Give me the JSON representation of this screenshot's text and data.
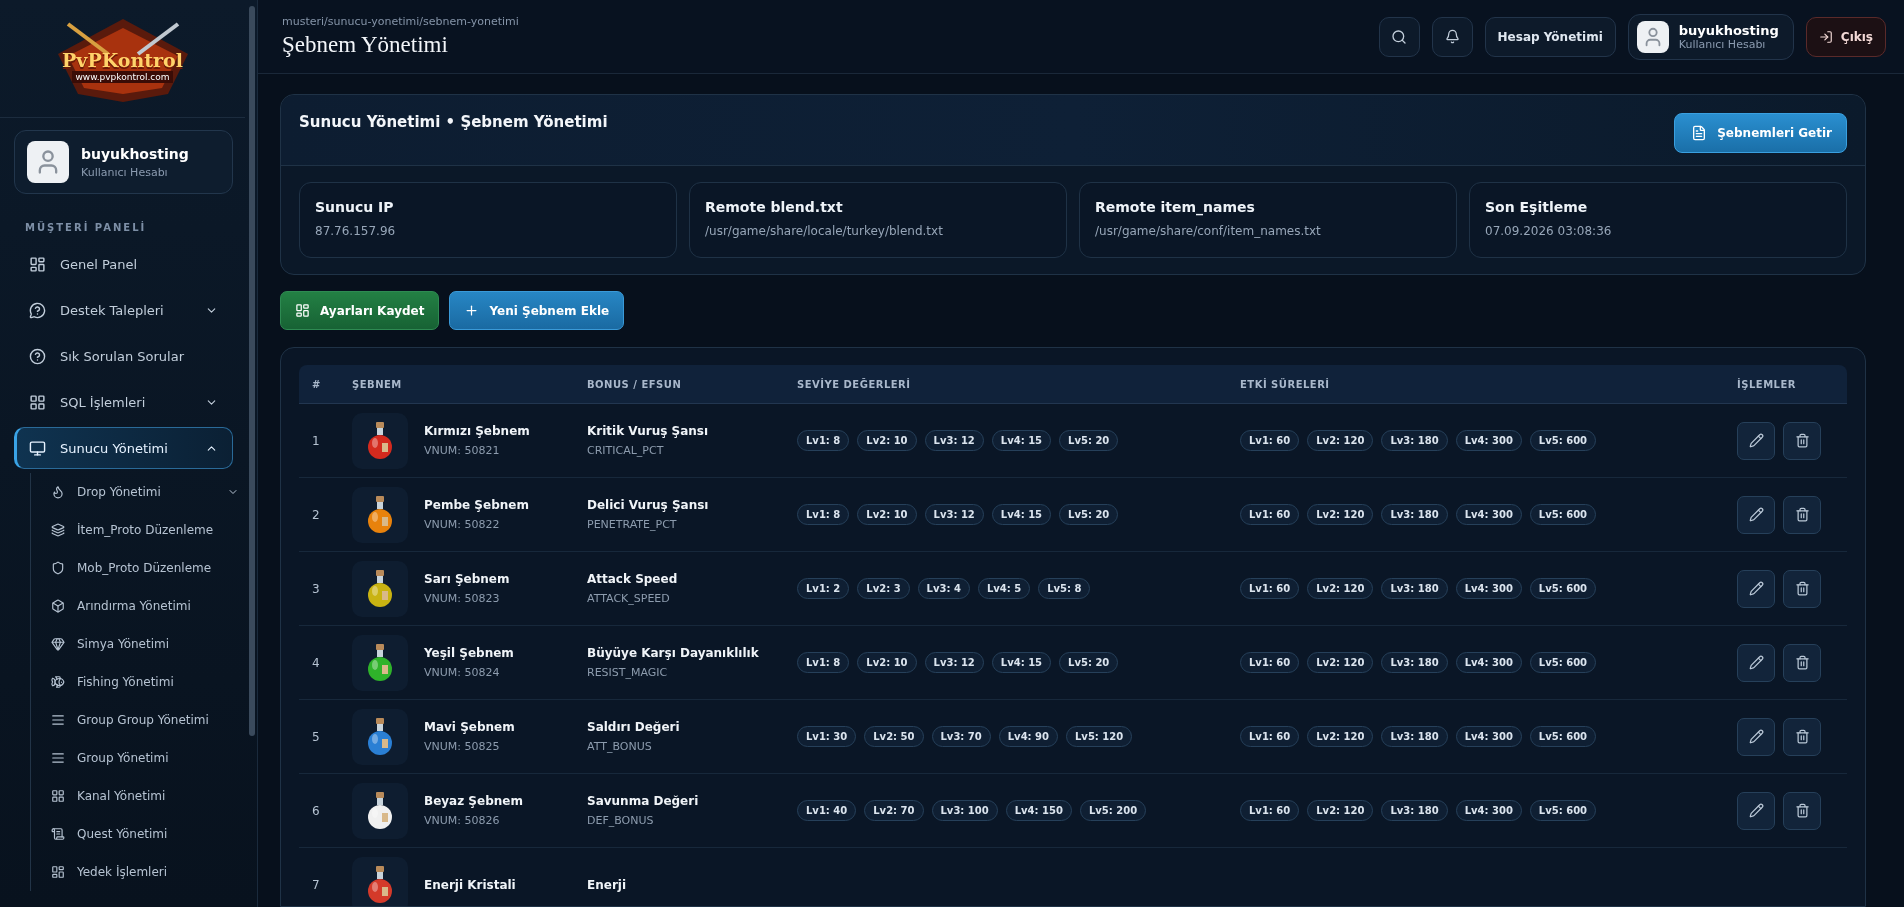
{
  "sidebar": {
    "logo": {
      "title": "PvPKontrol",
      "subtitle": "www.pvpkontrol.com"
    },
    "user": {
      "name": "buyukhosting",
      "role": "Kullanıcı Hesabı"
    },
    "section": "MÜŞTERİ PANELİ",
    "items": [
      {
        "label": "Genel Panel",
        "selected": false
      },
      {
        "label": "Destek Talepleri",
        "selected": false,
        "expanded": false
      },
      {
        "label": "Sık Sorulan Sorular",
        "selected": false
      },
      {
        "label": "SQL İşlemleri",
        "selected": false,
        "expanded": false
      },
      {
        "label": "Sunucu Yönetimi",
        "selected": true,
        "expanded": true,
        "children": [
          {
            "label": "Drop Yönetimi",
            "expanded": false
          },
          {
            "label": "İtem_Proto Düzenleme"
          },
          {
            "label": "Mob_Proto Düzenleme"
          },
          {
            "label": "Arındırma Yönetimi"
          },
          {
            "label": "Simya Yönetimi"
          },
          {
            "label": "Fishing Yönetimi"
          },
          {
            "label": "Group Group Yönetimi"
          },
          {
            "label": "Group Yönetimi"
          },
          {
            "label": "Kanal Yönetimi"
          },
          {
            "label": "Quest Yönetimi"
          },
          {
            "label": "Yedek İşlemleri"
          }
        ]
      }
    ]
  },
  "header": {
    "breadcrumb": "musteri/sunucu-yonetimi/sebnem-yonetimi",
    "title": "Şebnem Yönetimi",
    "account_button": "Hesap Yönetimi",
    "user": {
      "name": "buyukhosting",
      "role": "Kullanıcı Hesabı"
    },
    "logout": "Çıkış"
  },
  "panel": {
    "title": "Sunucu Yönetimi • Şebnem Yönetimi",
    "fetch_button": "Şebnemleri Getir",
    "info": [
      {
        "label": "Sunucu IP",
        "value": "87.76.157.96"
      },
      {
        "label": "Remote blend.txt",
        "value": "/usr/game/share/locale/turkey/blend.txt"
      },
      {
        "label": "Remote item_names",
        "value": "/usr/game/share/conf/item_names.txt"
      },
      {
        "label": "Son Eşitleme",
        "value": "07.09.2026 03:08:36"
      }
    ]
  },
  "actions": {
    "save": "Ayarları Kaydet",
    "add": "Yeni Şebnem Ekle"
  },
  "table": {
    "columns": [
      "#",
      "ŞEBNEM",
      "BONUS / EFSUN",
      "SEVİYE DEĞERLERİ",
      "ETKİ SÜRELERİ",
      "İŞLEMLER"
    ],
    "rows": [
      {
        "index": "1",
        "name": "Kırmızı Şebnem",
        "vnum": "VNUM: 50821",
        "color": "#d42a1e",
        "bonus": "Kritik Vuruş Şansı",
        "code": "CRITICAL_PCT",
        "levels": [
          "Lv1: 8",
          "Lv2: 10",
          "Lv3: 12",
          "Lv4: 15",
          "Lv5: 20"
        ],
        "durations": [
          "Lv1: 60",
          "Lv2: 120",
          "Lv3: 180",
          "Lv4: 300",
          "Lv5: 600"
        ]
      },
      {
        "index": "2",
        "name": "Pembe Şebnem",
        "vnum": "VNUM: 50822",
        "color": "#e8820c",
        "bonus": "Delici Vuruş Şansı",
        "code": "PENETRATE_PCT",
        "levels": [
          "Lv1: 8",
          "Lv2: 10",
          "Lv3: 12",
          "Lv4: 15",
          "Lv5: 20"
        ],
        "durations": [
          "Lv1: 60",
          "Lv2: 120",
          "Lv3: 180",
          "Lv4: 300",
          "Lv5: 600"
        ]
      },
      {
        "index": "3",
        "name": "Sarı Şebnem",
        "vnum": "VNUM: 50823",
        "color": "#c9b312",
        "bonus": "Attack Speed",
        "code": "ATTACK_SPEED",
        "levels": [
          "Lv1: 2",
          "Lv2: 3",
          "Lv3: 4",
          "Lv4: 5",
          "Lv5: 8"
        ],
        "durations": [
          "Lv1: 60",
          "Lv2: 120",
          "Lv3: 180",
          "Lv4: 300",
          "Lv5: 600"
        ]
      },
      {
        "index": "4",
        "name": "Yeşil Şebnem",
        "vnum": "VNUM: 50824",
        "color": "#2fb32a",
        "bonus": "Büyüye Karşı Dayanıklılık",
        "code": "RESIST_MAGIC",
        "levels": [
          "Lv1: 8",
          "Lv2: 10",
          "Lv3: 12",
          "Lv4: 15",
          "Lv5: 20"
        ],
        "durations": [
          "Lv1: 60",
          "Lv2: 120",
          "Lv3: 180",
          "Lv4: 300",
          "Lv5: 600"
        ]
      },
      {
        "index": "5",
        "name": "Mavi Şebnem",
        "vnum": "VNUM: 50825",
        "color": "#2a7fd4",
        "bonus": "Saldırı Değeri",
        "code": "ATT_BONUS",
        "levels": [
          "Lv1: 30",
          "Lv2: 50",
          "Lv3: 70",
          "Lv4: 90",
          "Lv5: 120"
        ],
        "durations": [
          "Lv1: 60",
          "Lv2: 120",
          "Lv3: 180",
          "Lv4: 300",
          "Lv5: 600"
        ]
      },
      {
        "index": "6",
        "name": "Beyaz Şebnem",
        "vnum": "VNUM: 50826",
        "color": "#f0f0f0",
        "bonus": "Savunma Değeri",
        "code": "DEF_BONUS",
        "levels": [
          "Lv1: 40",
          "Lv2: 70",
          "Lv3: 100",
          "Lv4: 150",
          "Lv5: 200"
        ],
        "durations": [
          "Lv1: 60",
          "Lv2: 120",
          "Lv3: 180",
          "Lv4: 300",
          "Lv5: 600"
        ]
      },
      {
        "index": "7",
        "name": "Enerji Kristali",
        "color": "#d43a2a",
        "bonus": "Enerji"
      }
    ]
  }
}
